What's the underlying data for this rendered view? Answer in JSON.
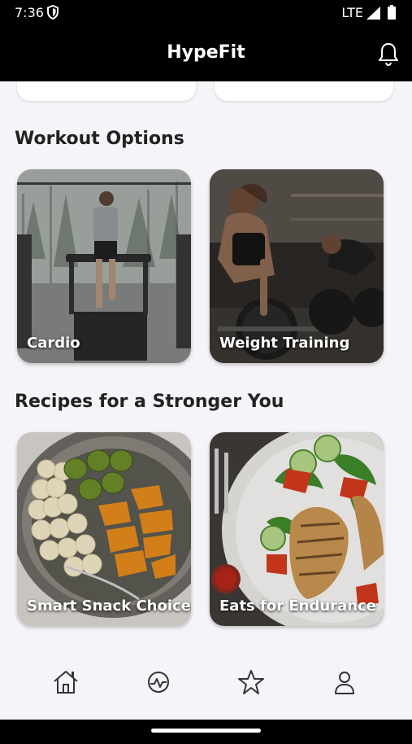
{
  "status_bar": {
    "time": "7:36",
    "network": "LTE"
  },
  "app_bar": {
    "title": "HypeFit"
  },
  "sections": {
    "workout": {
      "title": "Workout Options",
      "cards": [
        {
          "label": "Cardio"
        },
        {
          "label": "Weight Training"
        }
      ]
    },
    "recipes": {
      "title": "Recipes for a Stronger You",
      "cards": [
        {
          "label": "Smart Snack Choices"
        },
        {
          "label": "Eats for Endurance"
        }
      ]
    }
  },
  "bottom_nav": {
    "items": [
      {
        "icon": "home-icon"
      },
      {
        "icon": "activity-icon"
      },
      {
        "icon": "star-icon"
      },
      {
        "icon": "profile-icon"
      }
    ]
  }
}
